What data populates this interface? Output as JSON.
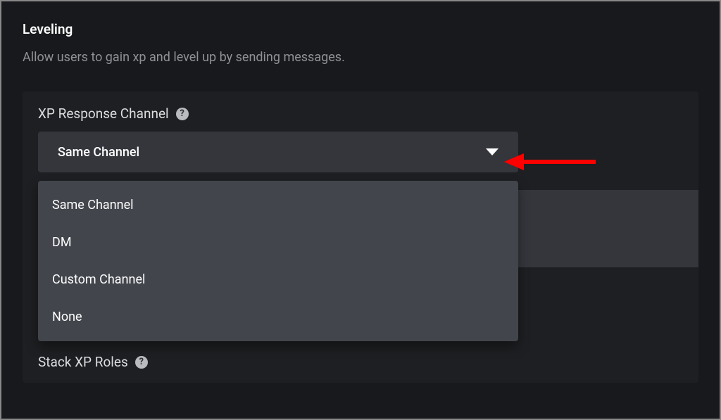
{
  "header": {
    "title": "Leveling",
    "description": "Allow users to gain xp and level up by sending messages."
  },
  "panel": {
    "field_label": "XP Response Channel",
    "selected_value": "Same Channel",
    "dropdown_options": [
      "Same Channel",
      "DM",
      "Custom Channel",
      "None"
    ],
    "hidden_marker": "*",
    "stack_label": "Stack XP Roles"
  },
  "icons": {
    "help": "?"
  }
}
